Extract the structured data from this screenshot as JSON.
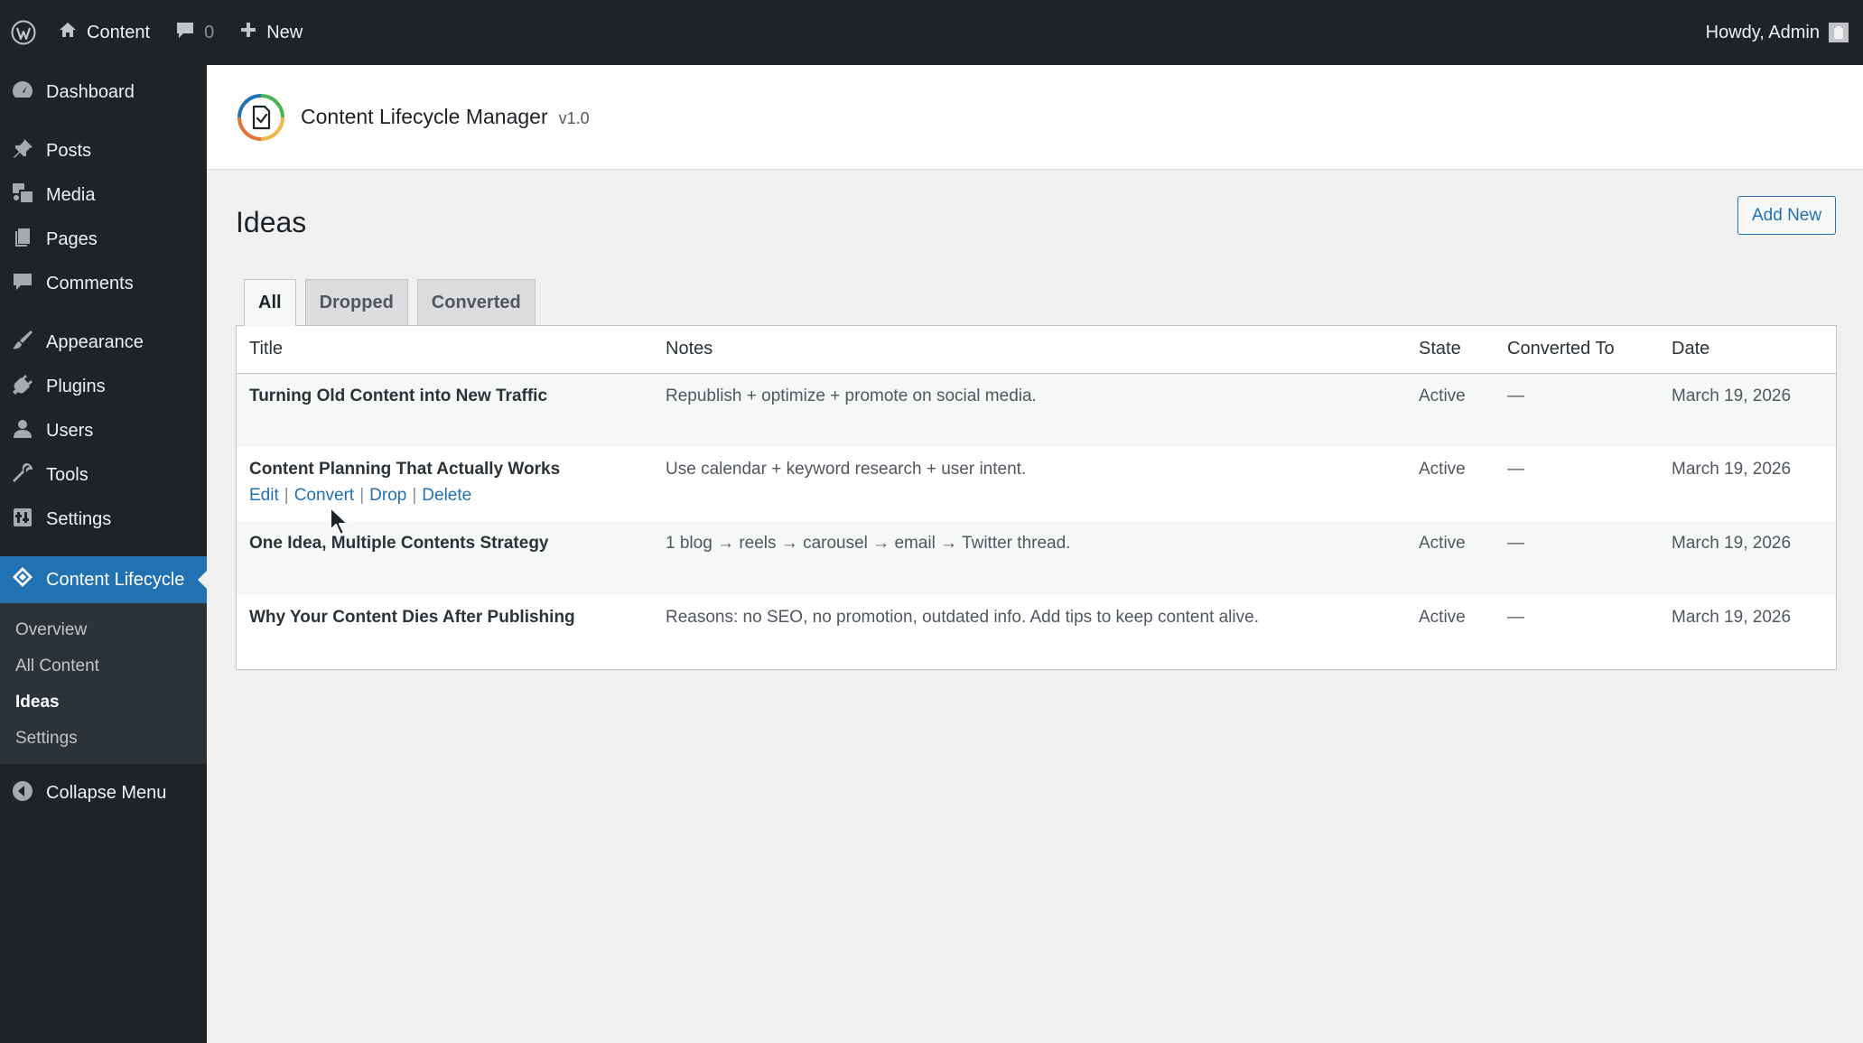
{
  "adminbar": {
    "site_name": "Content",
    "comments_count": "0",
    "new_label": "New",
    "greeting": "Howdy, Admin"
  },
  "sidebar": {
    "items": [
      {
        "label": "Dashboard",
        "icon": "dashboard-icon"
      },
      {
        "label": "Posts",
        "icon": "pin-icon"
      },
      {
        "label": "Media",
        "icon": "media-icon"
      },
      {
        "label": "Pages",
        "icon": "pages-icon"
      },
      {
        "label": "Comments",
        "icon": "comment-icon"
      },
      {
        "label": "Appearance",
        "icon": "brush-icon"
      },
      {
        "label": "Plugins",
        "icon": "plugin-icon"
      },
      {
        "label": "Users",
        "icon": "user-icon"
      },
      {
        "label": "Tools",
        "icon": "wrench-icon"
      },
      {
        "label": "Settings",
        "icon": "settings-icon"
      },
      {
        "label": "Content Lifecycle",
        "icon": "lifecycle-icon"
      }
    ],
    "submenu": [
      "Overview",
      "All Content",
      "Ideas",
      "Settings"
    ],
    "collapse_label": "Collapse Menu"
  },
  "plugin": {
    "title": "Content Lifecycle Manager",
    "version": "v1.0"
  },
  "page": {
    "title": "Ideas",
    "add_new_label": "Add New",
    "tabs": [
      "All",
      "Dropped",
      "Converted"
    ]
  },
  "table": {
    "columns": [
      "Title",
      "Notes",
      "State",
      "Converted To",
      "Date"
    ],
    "rows": [
      {
        "title": "Turning Old Content into New Traffic",
        "notes": "Republish + optimize + promote on social media.",
        "state": "Active",
        "converted_to": "—",
        "date": "March 19, 2026"
      },
      {
        "title": "Content Planning That Actually Works",
        "notes": "Use calendar + keyword research + user intent.",
        "state": "Active",
        "converted_to": "—",
        "date": "March 19, 2026"
      },
      {
        "title": "One Idea, Multiple Contents Strategy",
        "notes": "1 blog → reels → carousel → email → Twitter thread.",
        "state": "Active",
        "converted_to": "—",
        "date": "March 19, 2026"
      },
      {
        "title": "Why Your Content Dies After Publishing",
        "notes": "Reasons: no SEO, no promotion, outdated info. Add tips to keep content alive.",
        "state": "Active",
        "converted_to": "—",
        "date": "March 19, 2026"
      }
    ],
    "row_actions": [
      "Edit",
      "Convert",
      "Drop",
      "Delete"
    ]
  },
  "colors": {
    "accent": "#2271b1",
    "admin_dark": "#1d2327",
    "background": "#f0f0f1"
  }
}
